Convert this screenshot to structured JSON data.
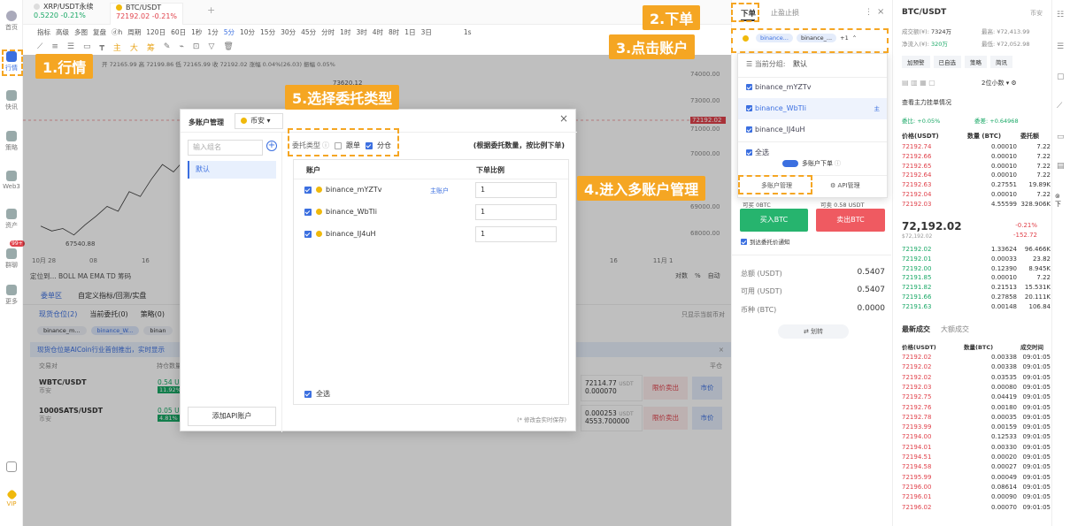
{
  "callouts": {
    "c1": "1.行情",
    "c2": "2.下单",
    "c3": "3.点击账户",
    "c4": "4.进入多账户管理",
    "c5": "5.选择委托类型"
  },
  "rail": [
    {
      "label": "首页"
    },
    {
      "label": "行情"
    },
    {
      "label": "快讯"
    },
    {
      "label": "策略"
    },
    {
      "label": "Web3"
    },
    {
      "label": "资产"
    },
    {
      "label": "群聊"
    },
    {
      "label": "更多"
    },
    {
      "label": "VIP"
    }
  ],
  "rail_badge": "99+",
  "tabs": [
    {
      "name": "XRP/USDT永续",
      "price": "0.5220",
      "change": "-0.21%"
    },
    {
      "name": "BTC/USDT",
      "price": "72192.02",
      "change": "-0.21%"
    }
  ],
  "tab_add": "+",
  "toolbar": {
    "items": [
      "指标",
      "高级",
      "多图",
      "复盘",
      "ⓓh",
      "周期",
      "120日",
      "60日",
      "1秒",
      "1分",
      "5分",
      "10分",
      "15分",
      "30分",
      "45分",
      "分时",
      "1时",
      "3时",
      "4时",
      "8时",
      "1日",
      "3日"
    ],
    "right": "1s"
  },
  "ohlc": "开 72165.99 高 72199.86 低 72165.99 收 72192.02 涨幅 0.04%(26.03) 振幅 0.05%",
  "chart": {
    "price_ticks": [
      "74000.00",
      "73000.00",
      "72192.02",
      "71000.00",
      "70000.00",
      "69000.00",
      "68000.00"
    ],
    "current_price_label": "72192.02",
    "high_label": "73620.12",
    "low_label": "67540.88",
    "x_labels": [
      "10月 28",
      "08",
      "16",
      "16",
      "11月 1"
    ],
    "legend": "定位到...   BOLL  MA  EMA  TD  筹码",
    "axis_ctrl": [
      "对数",
      "%",
      "自动"
    ],
    "line": [
      67900,
      67700,
      67800,
      67540,
      67950,
      68300,
      68700,
      68500,
      69300,
      69100,
      69800,
      70400,
      70100,
      70600,
      71100,
      70800,
      71400
    ]
  },
  "bottom": {
    "tabs": [
      "委单区",
      "自定义指标/回测/实盘"
    ],
    "subtabs": [
      "现货仓位(2)",
      "当前委托(0)",
      "策略(0)"
    ],
    "chips": [
      "binance_m...",
      "binance_W...",
      "binan"
    ],
    "banner": "现货仓位是AICoin行业首创推出，实时显示",
    "header": [
      "交易对",
      "持仓数量"
    ],
    "only_show": "只显示当前币对",
    "positions": [
      {
        "pair": "WBTC/USDT",
        "exch": "币安",
        "qty": "0.54 U",
        "pct": "11.92%",
        "price": "72114.77",
        "unit": "USDT",
        "amount": "0.000070",
        "sell": "限价卖出",
        "mkt": "市价"
      },
      {
        "pair": "1000SATS/USDT",
        "exch": "币安",
        "qty": "0.05 U",
        "pct": "4.81%",
        "price": "0.000253",
        "unit": "USDT",
        "amount": "4553.700000",
        "sell": "限价卖出",
        "mkt": "市价"
      }
    ],
    "pingcang": "平仓"
  },
  "modal": {
    "title": "多账户管理",
    "exchange": "币安",
    "group_placeholder": "输入组名",
    "group_default": "默认",
    "type_label": "委托类型",
    "opt1": "跟单",
    "opt2": "分仓",
    "hint": "(根据委托数量，按比例下单)",
    "col_account": "账户",
    "col_ratio": "下单比例",
    "accounts": [
      {
        "name": "binance_mYZTv",
        "tag": "主账户",
        "ratio": "1"
      },
      {
        "name": "binance_WbTli",
        "tag": "",
        "ratio": "1"
      },
      {
        "name": "binance_IJ4uH",
        "tag": "",
        "ratio": "1"
      }
    ],
    "select_all": "全选",
    "add_api": "添加API账户",
    "autosave": "(* 修改会实时保存)",
    "close": "×"
  },
  "order": {
    "tab_order": "下单",
    "tab_tp": "止盈止损",
    "chip1": "binance...",
    "chip2": "binance_...",
    "more": "+1",
    "group_label": "当前分组:",
    "group_value": "默认",
    "accounts": [
      "binance_mYZTv",
      "binance_WbTli",
      "binance_IJ4uH"
    ],
    "main_mark": "主",
    "select_all": "全选",
    "multi_order": "多账户下单",
    "multi_manage": "多账户管理",
    "api_manage": "API管理",
    "avail_btc": "可买 0BTC",
    "avail_usdt": "可卖 0.58 USDT",
    "buy": "买入BTC",
    "sell": "卖出BTC",
    "notify": "到达委托价通知",
    "total_label": "总额 (USDT)",
    "total": "0.5407",
    "avail_label": "可用 (USDT)",
    "avail": "0.5407",
    "coin_label": "币种 (BTC)",
    "coin": "0.0000",
    "transfer": "⇄ 划转"
  },
  "book": {
    "pair": "BTC/USDT",
    "exch": "币安",
    "vol_label": "成交额(¥):",
    "vol": "7324万",
    "high_label": "最高:",
    "high": "¥72,413.99",
    "net_label": "净流入(¥):",
    "net": "320万",
    "low_label": "最低:",
    "low": "¥72,052.98",
    "btns": [
      "加预警",
      "已自选",
      "策略",
      "简讯"
    ],
    "decimal": "2位小数",
    "main_force": "查看主力挂单情况",
    "cmp1": "委比: +0.05%",
    "cmp2": "委差: +0.64968",
    "h1": "价格(USDT)",
    "h2": "数量 (BTC)",
    "h3": "委托额",
    "asks": [
      [
        "72192.74",
        "0.00010",
        "7.22"
      ],
      [
        "72192.66",
        "0.00010",
        "7.22"
      ],
      [
        "72192.65",
        "0.00010",
        "7.22"
      ],
      [
        "72192.64",
        "0.00010",
        "7.22"
      ],
      [
        "72192.63",
        "0.27551",
        "19.89K"
      ],
      [
        "72192.04",
        "0.00010",
        "7.22"
      ],
      [
        "72192.03",
        "4.55599",
        "328.906K"
      ]
    ],
    "last": "72,192.02",
    "last_cny": "$72,192.02",
    "last_chg": "-0.21%",
    "last_diff": "-152.72",
    "bids": [
      [
        "72192.02",
        "1.33624",
        "96.466K"
      ],
      [
        "72192.01",
        "0.00033",
        "23.82"
      ],
      [
        "72192.00",
        "0.12390",
        "8.945K"
      ],
      [
        "72191.85",
        "0.00010",
        "7.22"
      ],
      [
        "72191.82",
        "0.21513",
        "15.531K"
      ],
      [
        "72191.66",
        "0.27858",
        "20.111K"
      ],
      [
        "72191.63",
        "0.00148",
        "106.84"
      ]
    ],
    "trade_tab1": "最新成交",
    "trade_tab2": "大额成交",
    "t1": "价格(USDT)",
    "t2": "数量(BTC)",
    "t3": "成交时间",
    "trades": [
      [
        "72192.02",
        "0.00338",
        "09:01:05"
      ],
      [
        "72192.02",
        "0.00338",
        "09:01:05"
      ],
      [
        "72192.02",
        "0.03535",
        "09:01:05"
      ],
      [
        "72192.03",
        "0.00080",
        "09:01:05"
      ],
      [
        "72192.75",
        "0.04419",
        "09:01:05"
      ],
      [
        "72192.76",
        "0.00180",
        "09:01:05"
      ],
      [
        "72192.78",
        "0.00035",
        "09:01:05"
      ],
      [
        "72193.99",
        "0.00159",
        "09:01:05"
      ],
      [
        "72194.00",
        "0.12533",
        "09:01:05"
      ],
      [
        "72194.01",
        "0.00330",
        "09:01:05"
      ],
      [
        "72194.51",
        "0.00020",
        "09:01:05"
      ],
      [
        "72194.58",
        "0.00027",
        "09:01:05"
      ],
      [
        "72195.99",
        "0.00049",
        "09:01:05"
      ],
      [
        "72196.00",
        "0.08614",
        "09:01:05"
      ],
      [
        "72196.01",
        "0.00090",
        "09:01:05"
      ],
      [
        "72196.02",
        "0.00070",
        "09:01:05"
      ]
    ]
  }
}
